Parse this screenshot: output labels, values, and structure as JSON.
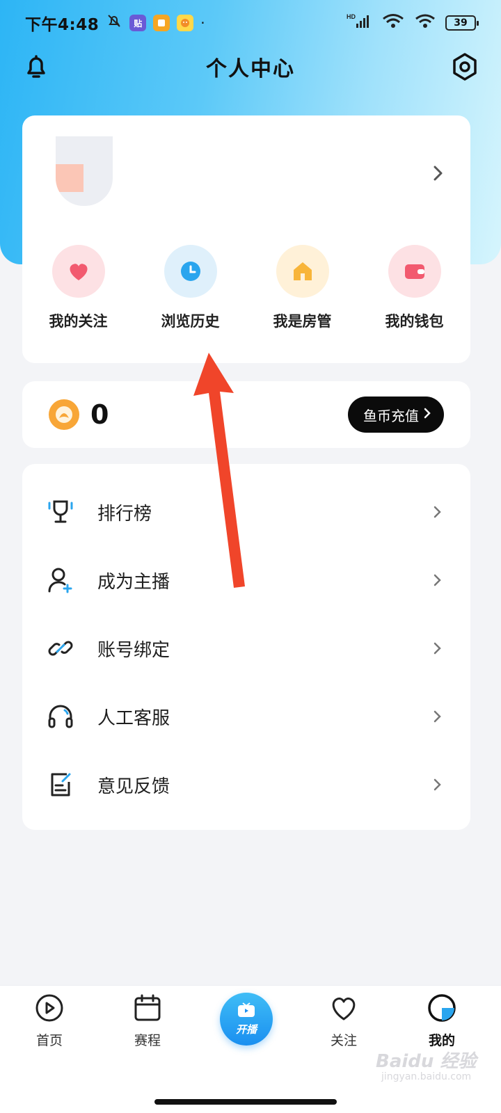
{
  "status_bar": {
    "time": "下午4:48",
    "notif_app_label": "贴",
    "network": "HD",
    "battery": "39"
  },
  "header": {
    "title": "个人中心"
  },
  "quick_actions": [
    {
      "label": "我的关注",
      "icon": "heart-icon",
      "bg": "#fde1e4",
      "color": "#f25a6f"
    },
    {
      "label": "浏览历史",
      "icon": "clock-icon",
      "bg": "#dff0fb",
      "color": "#2aa5ee"
    },
    {
      "label": "我是房管",
      "icon": "house-icon",
      "bg": "#fff1d8",
      "color": "#f8b53a"
    },
    {
      "label": "我的钱包",
      "icon": "wallet-icon",
      "bg": "#fde1e4",
      "color": "#f25a6f"
    }
  ],
  "coins": {
    "amount": "0",
    "recharge_label": "鱼币充值"
  },
  "menu": [
    {
      "label": "排行榜",
      "icon": "trophy-icon"
    },
    {
      "label": "成为主播",
      "icon": "add-user-icon"
    },
    {
      "label": "账号绑定",
      "icon": "link-icon"
    },
    {
      "label": "人工客服",
      "icon": "headset-icon"
    },
    {
      "label": "意见反馈",
      "icon": "feedback-icon"
    }
  ],
  "bottom_nav": {
    "home": "首页",
    "schedule": "赛程",
    "broadcast": "开播",
    "follow": "关注",
    "mine": "我的"
  },
  "watermark": {
    "text": "Baidu 经验",
    "sub": "jingyan.baidu.com"
  },
  "colors": {
    "accent": "#2aa5ee",
    "annotation": "#f0452a"
  }
}
